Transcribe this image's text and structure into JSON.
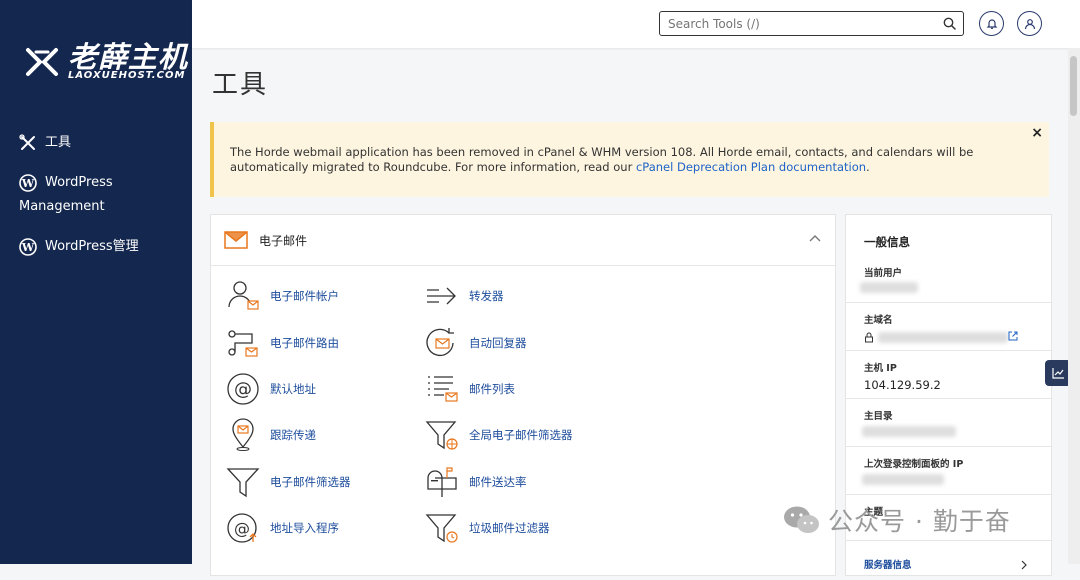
{
  "sidebar": {
    "logo": {
      "name": "老薛主机",
      "sub": "LAOXUEHOST.COM"
    },
    "items": [
      {
        "label": "工具",
        "icon": "tools-icon"
      },
      {
        "label": "WordPress Management",
        "icon": "wordpress-icon"
      },
      {
        "label": "WordPress管理",
        "icon": "wordpress-icon"
      }
    ]
  },
  "topbar": {
    "search_placeholder": "Search Tools (/)"
  },
  "page": {
    "title": "工具"
  },
  "notice": {
    "text": "The Horde webmail application has been removed in cPanel & WHM version 108. All Horde email, contacts, and calendars will be automatically migrated to Roundcube. For more information, read our ",
    "link": "cPanel Deprecation Plan documentation",
    "suffix": ".",
    "close": "×"
  },
  "email_panel": {
    "title": "电子邮件",
    "tools": [
      {
        "label": "电子邮件帐户",
        "icon": "email-account-icon"
      },
      {
        "label": "转发器",
        "icon": "forwarder-icon"
      },
      {
        "label": "电子邮件路由",
        "icon": "email-routing-icon"
      },
      {
        "label": "自动回复器",
        "icon": "autoresponder-icon"
      },
      {
        "label": "默认地址",
        "icon": "default-address-icon"
      },
      {
        "label": "邮件列表",
        "icon": "mailing-list-icon"
      },
      {
        "label": "跟踪传递",
        "icon": "track-delivery-icon"
      },
      {
        "label": "全局电子邮件筛选器",
        "icon": "global-filter-icon"
      },
      {
        "label": "电子邮件筛选器",
        "icon": "email-filter-icon"
      },
      {
        "label": "邮件送达率",
        "icon": "deliverability-icon"
      },
      {
        "label": "地址导入程序",
        "icon": "address-importer-icon"
      },
      {
        "label": "垃圾邮件过滤器",
        "icon": "spam-filter-icon"
      }
    ]
  },
  "info_panel": {
    "title": "一般信息",
    "rows": [
      {
        "label": "当前用户",
        "value": ""
      },
      {
        "label": "主域名",
        "value": ""
      },
      {
        "label": "主机 IP",
        "value": "104.129.59.2"
      },
      {
        "label": "主目录",
        "value": ""
      },
      {
        "label": "上次登录控制面板的 IP",
        "value": ""
      },
      {
        "label": "主题",
        "value": ""
      },
      {
        "label": "服务器信息",
        "value": ""
      }
    ]
  },
  "watermark": {
    "text": "公众号 · 勤于奋"
  }
}
